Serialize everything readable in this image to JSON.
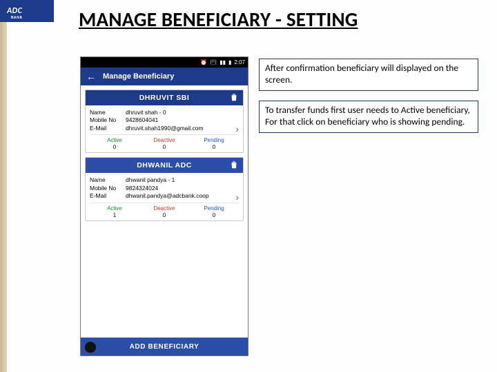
{
  "logo": {
    "brand": "ADC",
    "sub": "BANK"
  },
  "slide_title": "MANAGE BENEFICIARY - SETTING",
  "callouts": {
    "c1": "After confirmation beneficiary will displayed on the screen.",
    "c2": "To transfer funds first user needs to Active beneficiary, For that click on beneficiary who is showing pending."
  },
  "phone": {
    "status": {
      "time": "2:07"
    },
    "appbar": {
      "title": "Manage Beneficiary"
    },
    "cards": [
      {
        "title": "DHRUVIT SBI",
        "fields": {
          "name_label": "Name",
          "name_value": "dhruvit shah - 0",
          "mobile_label": "Mobile No",
          "mobile_value": "9428604041",
          "email_label": "E-Mail",
          "email_value": "dhruvit.shah1990@gmail.com"
        },
        "stats": {
          "active_label": "Active",
          "active": "0",
          "deactive_label": "Deactive",
          "deactive": "0",
          "pending_label": "Pending",
          "pending": "0"
        }
      },
      {
        "title": "DHWANIL ADC",
        "fields": {
          "name_label": "Name",
          "name_value": "dhwanil pandya - 1",
          "mobile_label": "Mobile No",
          "mobile_value": "9824324024",
          "email_label": "E-Mail",
          "email_value": "dhwanil.pandya@adcbank.coop"
        },
        "stats": {
          "active_label": "Active",
          "active": "1",
          "deactive_label": "Deactive",
          "deactive": "0",
          "pending_label": "Pending",
          "pending": "0"
        }
      }
    ],
    "footer": {
      "label": "ADD BENEFICIARY"
    }
  }
}
